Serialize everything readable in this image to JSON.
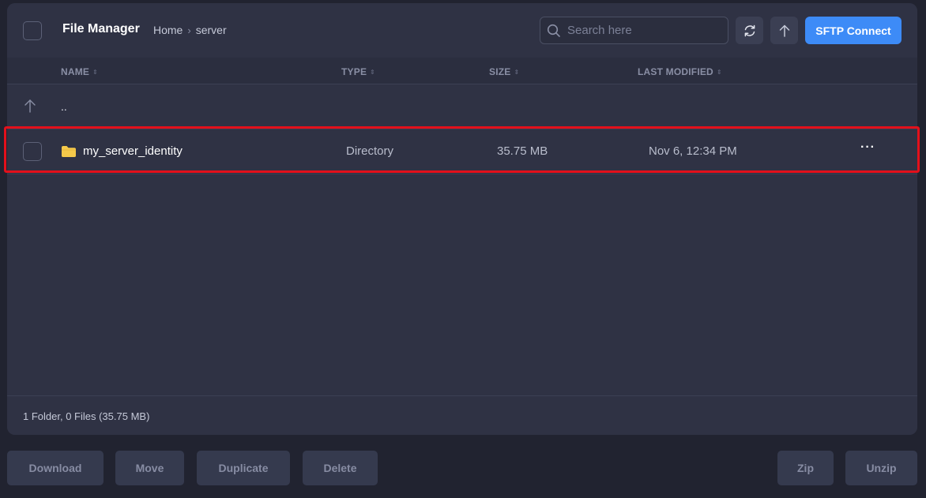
{
  "header": {
    "title": "File Manager",
    "breadcrumbs": [
      "Home",
      "server"
    ],
    "search_placeholder": "Search here",
    "sftp_label": "SFTP Connect"
  },
  "columns": {
    "name": "NAME",
    "type": "TYPE",
    "size": "SIZE",
    "modified": "LAST MODIFIED"
  },
  "parent_row": {
    "label": ".."
  },
  "files": [
    {
      "name": "my_server_identity",
      "type": "Directory",
      "size": "35.75 MB",
      "modified": "Nov 6, 12:34 PM",
      "icon": "folder-icon"
    }
  ],
  "footer": {
    "summary": "1 Folder, 0 Files (35.75 MB)"
  },
  "actions": {
    "download": "Download",
    "move": "Move",
    "duplicate": "Duplicate",
    "delete": "Delete",
    "zip": "Zip",
    "unzip": "Unzip"
  },
  "colors": {
    "accent": "#3d8bf7",
    "highlight": "#e3101b",
    "folder": "#f5c94a"
  }
}
